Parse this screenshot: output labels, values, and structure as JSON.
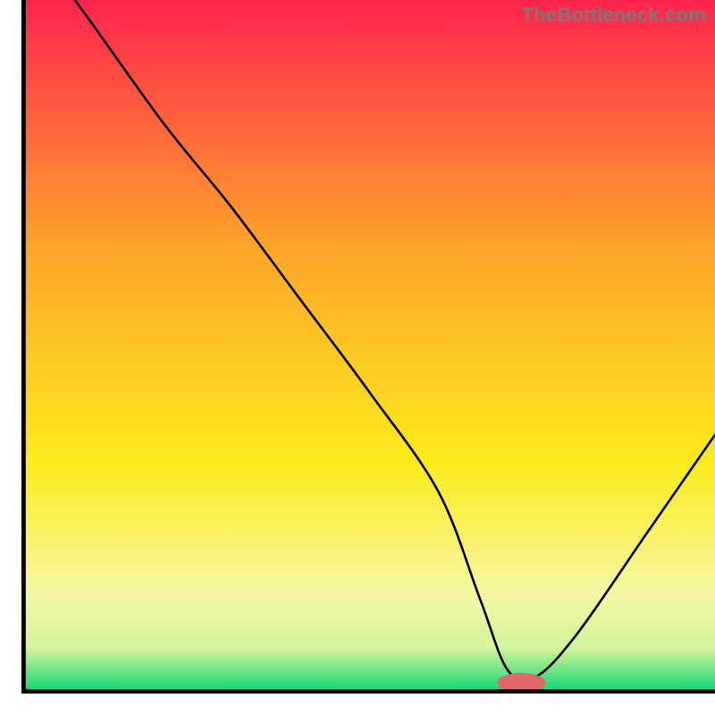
{
  "watermark": "TheBottleneck.com",
  "chart_data": {
    "type": "line",
    "title": "",
    "xlabel": "",
    "ylabel": "",
    "xlim": [
      0,
      100
    ],
    "ylim": [
      0,
      100
    ],
    "grid": false,
    "legend": false,
    "colors": {
      "gradient_top": "#ff1951",
      "gradient_mid_upper": "#fda52a",
      "gradient_mid": "#fceb1c",
      "gradient_mid_lower": "#f6f7a2",
      "gradient_low": "#d2f49a",
      "gradient_bottom": "#0fd774",
      "line": "#000000",
      "marker_fill": "#e0666b",
      "axis": "#000000"
    },
    "series": [
      {
        "name": "bottleneck-curve",
        "x": [
          0,
          5,
          20,
          30,
          40,
          50,
          60,
          66,
          70,
          74,
          80,
          90,
          100
        ],
        "y": [
          103,
          100,
          80,
          68,
          55,
          42,
          28,
          13,
          3,
          2,
          8,
          22,
          36
        ]
      }
    ],
    "marker": {
      "x": 72,
      "y": 1.2,
      "rx": 3.5,
      "ry": 1.4
    },
    "axes_box": {
      "x0": 3.3,
      "y0": 3.3,
      "x1": 100,
      "y1": 103
    }
  }
}
